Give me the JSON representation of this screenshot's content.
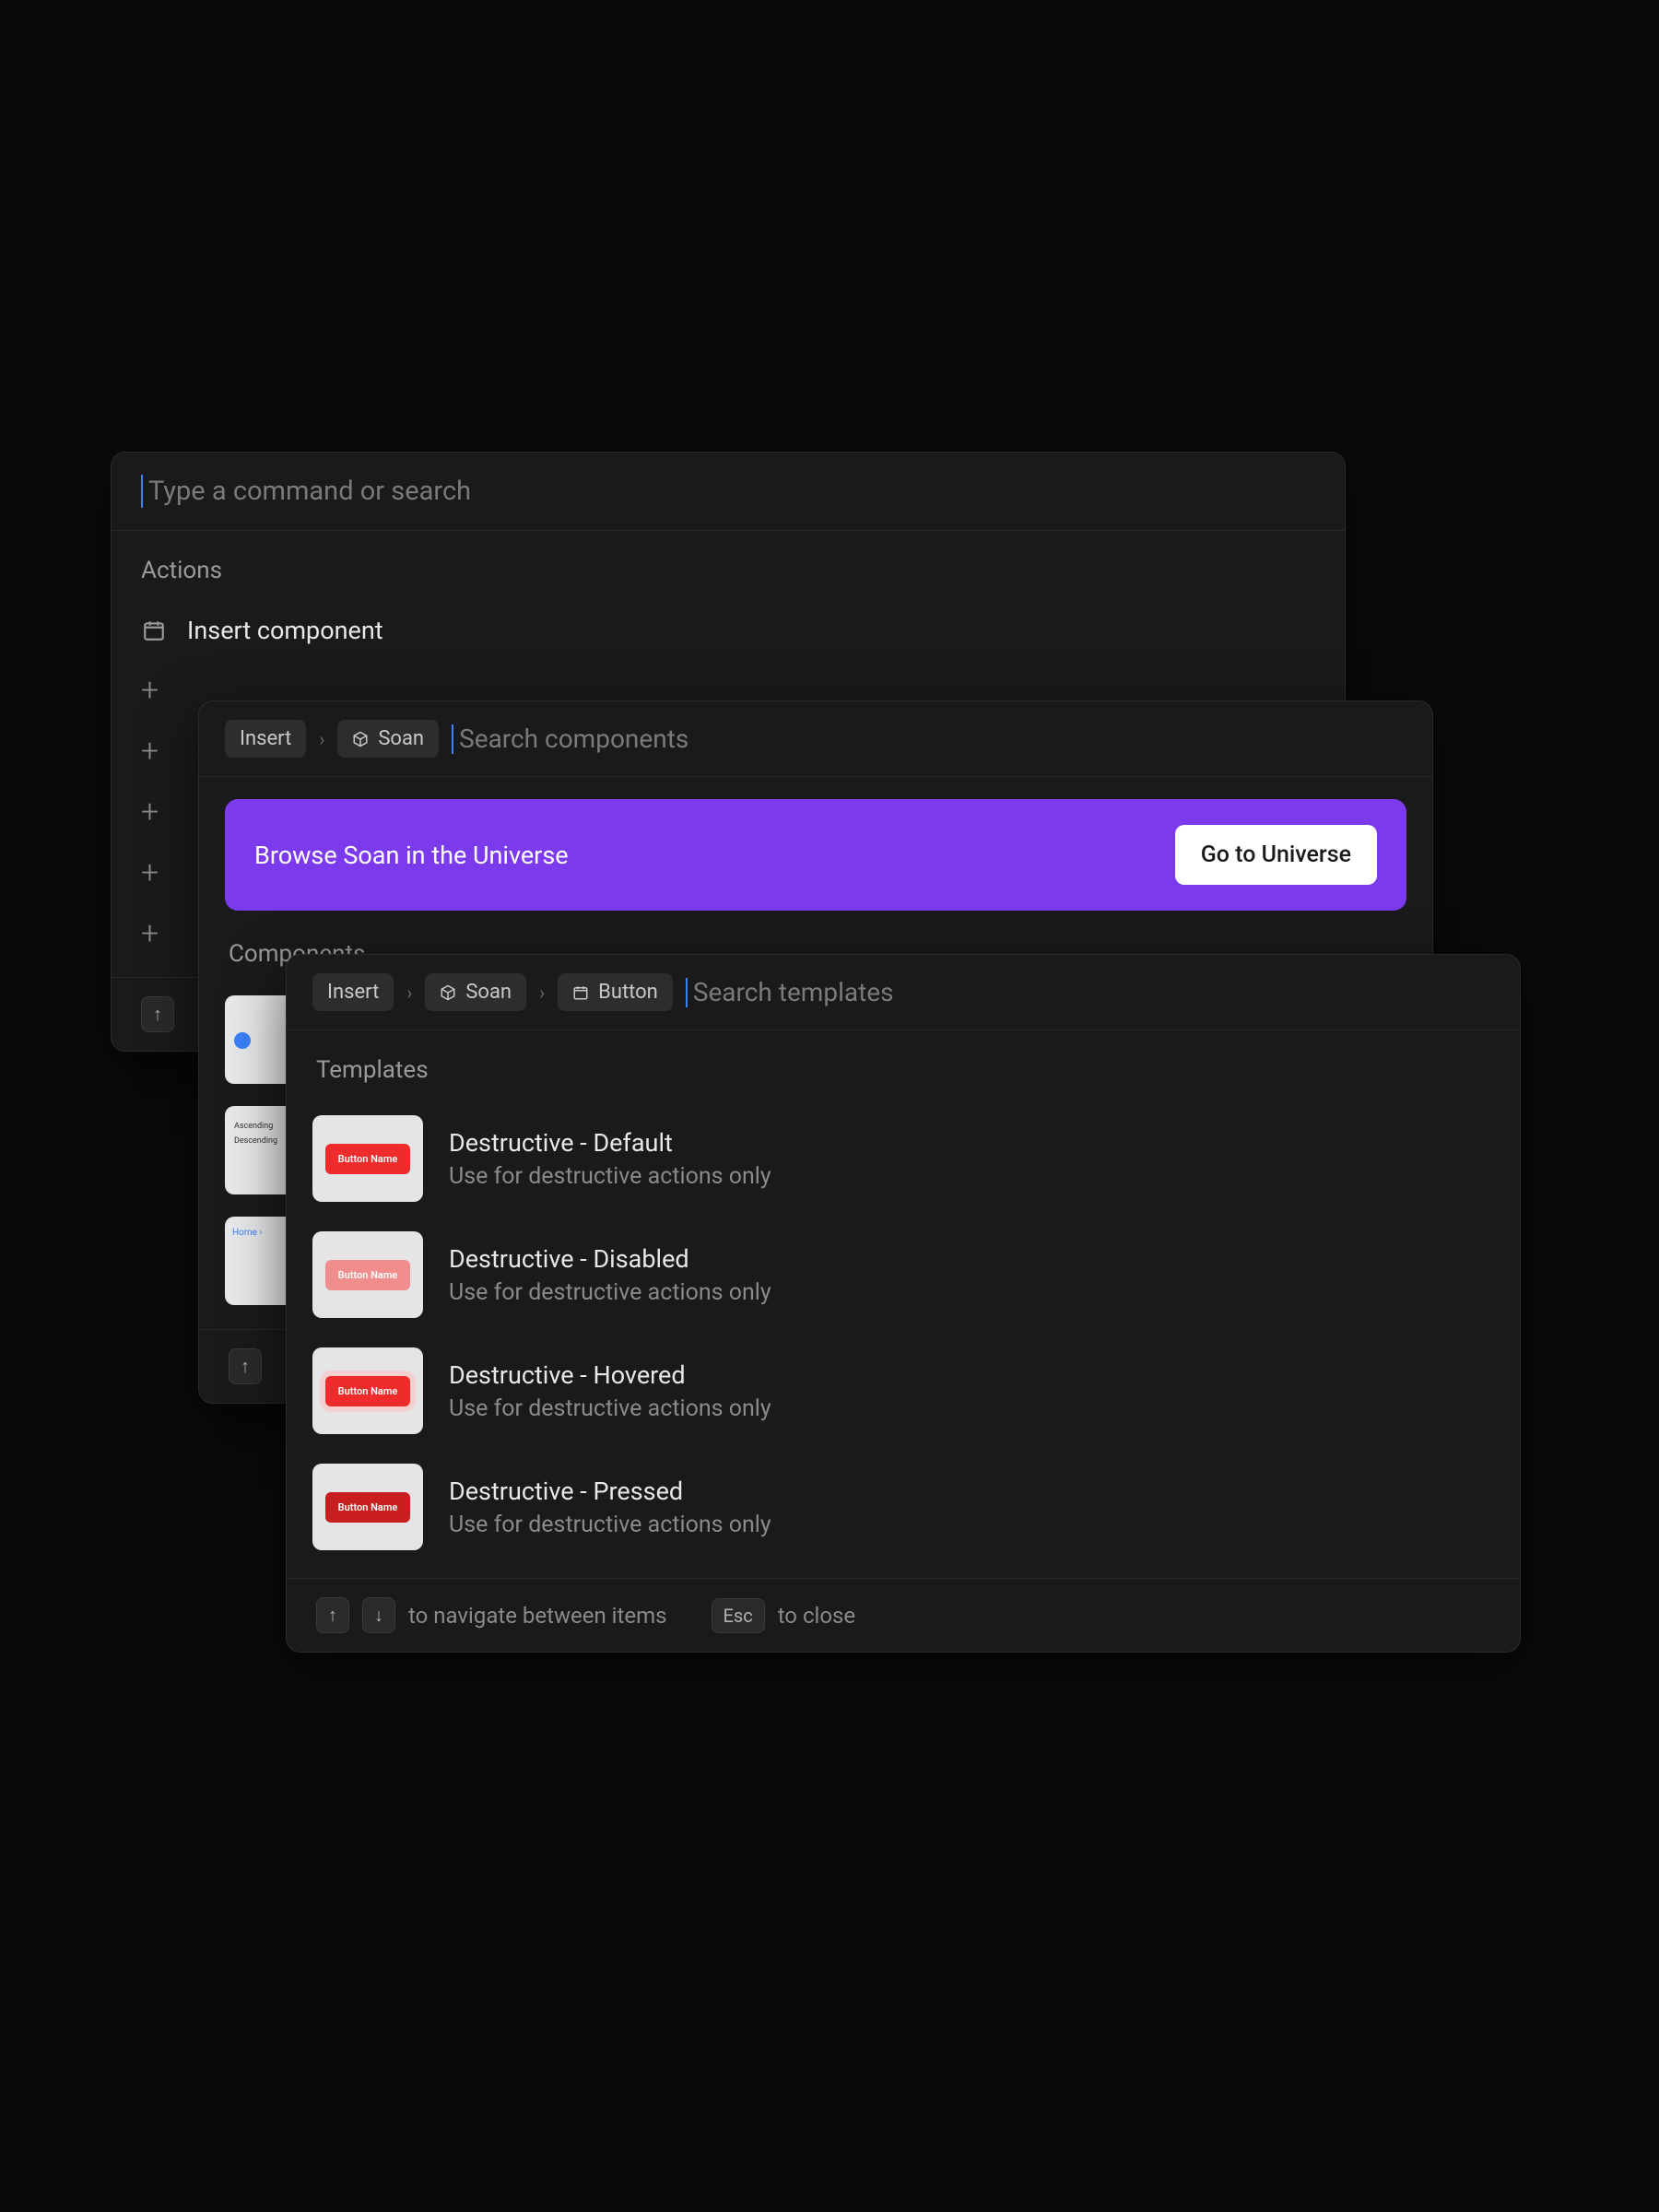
{
  "panel1": {
    "search_placeholder": "Type a command or search",
    "actions_label": "Actions",
    "actions": [
      {
        "label": "Insert component",
        "icon": "calendar"
      },
      {
        "label": "",
        "icon": "plus"
      },
      {
        "label": "",
        "icon": "plus"
      },
      {
        "label": "",
        "icon": "plus"
      },
      {
        "label": "",
        "icon": "plus"
      },
      {
        "label": "",
        "icon": "plus"
      }
    ],
    "footer_key": "↑"
  },
  "panel2": {
    "crumb_insert": "Insert",
    "crumb_soan": "Soan",
    "search_placeholder": "Search components",
    "banner_text": "Browse Soan in the Universe",
    "banner_button": "Go to Universe",
    "components_label": "Components",
    "thumbs": {
      "list_a": "Ascending",
      "list_b": "Descending",
      "bc_home": "Home",
      "bc_sep": "›"
    },
    "footer_key": "↑"
  },
  "panel3": {
    "crumb_insert": "Insert",
    "crumb_soan": "Soan",
    "crumb_button": "Button",
    "search_placeholder": "Search templates",
    "templates_label": "Templates",
    "button_chip_label": "Button Name",
    "templates": [
      {
        "title": "Destructive - Default",
        "desc": "Use for destructive actions only",
        "variant": "default"
      },
      {
        "title": "Destructive - Disabled",
        "desc": "Use for destructive actions only",
        "variant": "disabled"
      },
      {
        "title": "Destructive - Hovered",
        "desc": "Use for destructive actions only",
        "variant": "hover"
      },
      {
        "title": "Destructive - Pressed",
        "desc": "Use for destructive actions only",
        "variant": "pressed"
      }
    ],
    "footer": {
      "key_up": "↑",
      "key_down": "↓",
      "nav_text": "to navigate between items",
      "key_esc": "Esc",
      "close_text": "to close"
    }
  }
}
